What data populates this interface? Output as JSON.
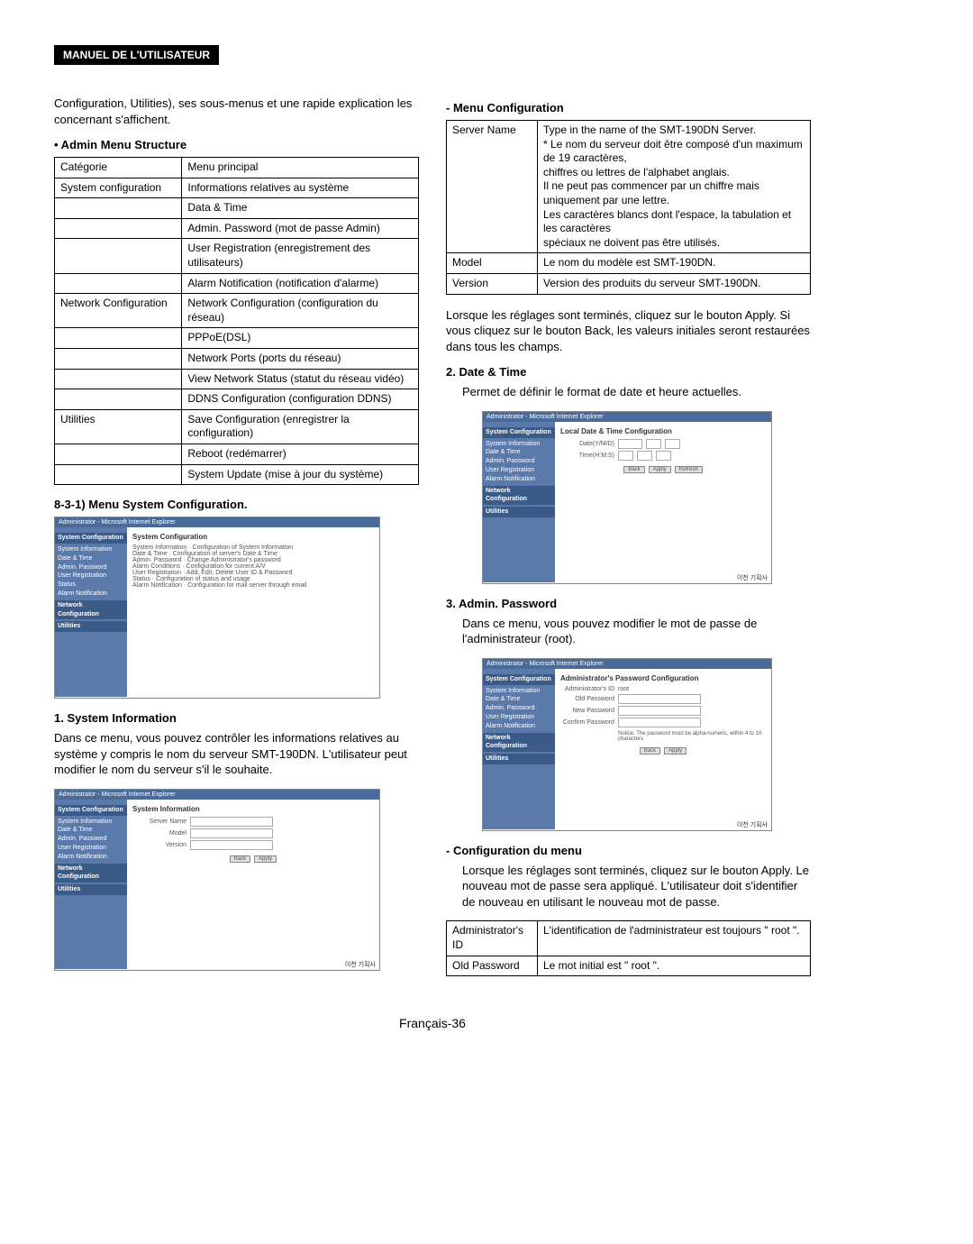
{
  "header": "MANUEL DE L'UTILISATEUR",
  "left": {
    "intro": "Configuration, Utilities), ses sous-menus et une rapide explication les concernant s'affichent.",
    "adminMenuTitle": "• Admin Menu Structure",
    "adminTable": {
      "h1": "Catégorie",
      "h2": "Menu principal",
      "r1a": "System configuration",
      "r1b": "Informations relatives au système",
      "r2b": "Data & Time",
      "r3b": "Admin. Password (mot de passe Admin)",
      "r4b": "User Registration (enregistrement des utilisateurs)",
      "r5b": "Alarm Notification (notification d'alarme)",
      "r6a": "Network Configuration",
      "r6b": "Network Configuration (configuration du réseau)",
      "r7b": "PPPoE(DSL)",
      "r8b": "Network Ports (ports du réseau)",
      "r9b": "View Network Status (statut du réseau vidéo)",
      "r10b": "DDNS Configuration (configuration DDNS)",
      "r11a": "Utilities",
      "r11b": "Save Configuration (enregistrer la configuration)",
      "r12b": "Reboot (redémarrer)",
      "r13b": "System Update (mise à jour du système)"
    },
    "menuSysConfig": "8-3-1) Menu System Configuration.",
    "sysInfoTitle": "1. System Information",
    "sysInfoText": "Dans ce menu, vous pouvez contrôler les informations relatives au système y compris le nom du serveur SMT-190DN. L'utilisateur peut modifier le nom du serveur s'il le souhaite.",
    "scr1": {
      "title": "Administrator - Microsoft Internet Explorer",
      "panel": "System Configuration",
      "side1": "System Information",
      "side2": "Date & Time",
      "side3": "Admin. Password",
      "side4": "User Registration",
      "side5": "Status",
      "side6": "Alarm Notification",
      "grp1": "System Configuration",
      "grp2": "Network Configuration",
      "grp3": "Utilities",
      "lines": [
        "System Information · Configuration of System Information",
        "Date & Time · Configuration of server's Date & Time",
        "Admin. Password · Change Administrator's password",
        "Alarm Conditions · Configuration for current A/V",
        "User Registration · Add, Edit, Delete User ID & Password",
        "Status · Configuration of status and usage",
        "Alarm Notification · Configuration for mail server through email"
      ]
    },
    "scr2": {
      "title": "Administrator - Microsoft Internet Explorer",
      "panel": "System Information",
      "l1": "Server Name",
      "l2": "Model",
      "l3": "Version",
      "b1": "Back",
      "b2": "Apply"
    }
  },
  "right": {
    "menuConfigTitle": "- Menu Configuration",
    "mc": {
      "r1a": "Server Name",
      "r1b": "Type in the name of the SMT-190DN Server.\n* Le nom du serveur doit être composé d'un maximum de 19 caractères,\nchiffres ou lettres de l'alphabet anglais.\nIl ne peut pas commencer par un chiffre mais uniquement par une lettre.\nLes caractères blancs dont l'espace, la tabulation et les caractères\nspéciaux ne doivent pas être utilisés.",
      "r2a": "Model",
      "r2b": "Le nom du modèle est SMT-190DN.",
      "r3a": "Version",
      "r3b": "Version des produits du serveur SMT-190DN."
    },
    "mcAfter": "Lorsque les réglages sont terminés, cliquez sur le bouton Apply. Si vous cliquez sur le bouton Back, les valeurs initiales seront restaurées dans tous les champs.",
    "dateTitle": "2. Date & Time",
    "dateText": "Permet de définir le format de date et heure actuelles.",
    "scr3": {
      "title": "Administrator - Microsoft Internet Explorer",
      "panel": "Local Date & Time Configuration",
      "l1": "Date(Y/M/D)",
      "l2": "Time(H:M:S)",
      "b1": "Back",
      "b2": "Apply",
      "b3": "Refresh"
    },
    "adminPwTitle": "3. Admin. Password",
    "adminPwText": "Dans ce menu, vous pouvez modifier le mot de passe de l'administrateur (root).",
    "scr4": {
      "title": "Administrator - Microsoft Internet Explorer",
      "panel": "Administrator's Password Configuration",
      "l1": "Administrator's ID",
      "v1": "root",
      "l2": "Old Password",
      "l3": "New Password",
      "l4": "Confirm Password",
      "note": "Notice: The password must be alpha-numeric, within 4 to 10 characters",
      "b1": "Back",
      "b2": "Apply"
    },
    "cfgMenuTitle": "- Configuration du menu",
    "cfgMenuText": "Lorsque les réglages sont terminés, cliquez sur le bouton Apply. Le nouveau mot de passe sera appliqué. L'utilisateur doit s'identifier de nouveau en utilisant le nouveau mot de passe.",
    "pw": {
      "r1a": "Administrator's ID",
      "r1b": "L'identification de l'administrateur est toujours \" root \".",
      "r2a": "Old Password",
      "r2b": "Le mot initial est \" root \"."
    }
  },
  "pageNum": "Français-36",
  "footerRef": "이천 기획사"
}
